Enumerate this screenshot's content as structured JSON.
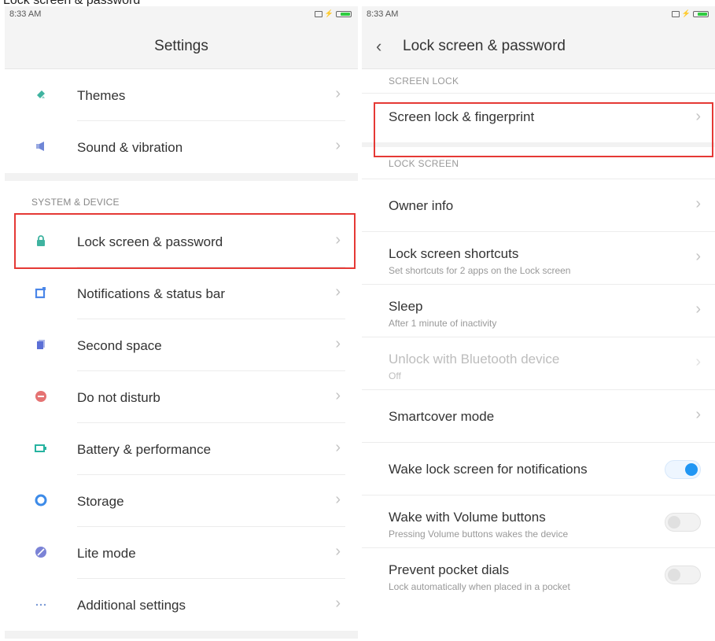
{
  "top_strip_text": "Lock screen & password",
  "left": {
    "status": {
      "time": "8:33 AM"
    },
    "title": "Settings",
    "items_top": [
      {
        "label": "Themes",
        "icon": "brush-icon",
        "color": "#3fb3a0"
      },
      {
        "label": "Sound & vibration",
        "icon": "speaker-icon",
        "color": "#6f86d6"
      }
    ],
    "section_header": "SYSTEM & DEVICE",
    "items": [
      {
        "label": "Lock screen & password",
        "icon": "lock-icon",
        "color": "#3fb3a0"
      },
      {
        "label": "Notifications & status bar",
        "icon": "notification-icon",
        "color": "#4a86e8"
      },
      {
        "label": "Second space",
        "icon": "stack-icon",
        "color": "#5b6fd6"
      },
      {
        "label": "Do not disturb",
        "icon": "do-not-disturb-icon",
        "color": "#e57373"
      },
      {
        "label": "Battery & performance",
        "icon": "battery-icon",
        "color": "#26b3a0"
      },
      {
        "label": "Storage",
        "icon": "storage-icon",
        "color": "#3d8be8"
      },
      {
        "label": "Lite mode",
        "icon": "lite-mode-icon",
        "color": "#7b83d6"
      },
      {
        "label": "Additional settings",
        "icon": "more-icon",
        "color": "#7a9ad6"
      }
    ],
    "chevron": "›"
  },
  "right": {
    "status": {
      "time": "8:33 AM"
    },
    "back": "‹",
    "title": "Lock screen & password",
    "section1_header": "SCREEN LOCK",
    "screen_lock": {
      "label": "Screen lock & fingerprint"
    },
    "section2_header": "LOCK SCREEN",
    "rows": [
      {
        "label": "Owner info"
      },
      {
        "label": "Lock screen shortcuts",
        "sub": "Set shortcuts for 2 apps on the Lock screen"
      },
      {
        "label": "Sleep",
        "sub": "After 1 minute of inactivity"
      },
      {
        "label": "Unlock with Bluetooth device",
        "sub": "Off",
        "disabled": true
      },
      {
        "label": "Smartcover mode"
      }
    ],
    "toggles": [
      {
        "label": "Wake lock screen for notifications",
        "on": true
      },
      {
        "label": "Wake with Volume buttons",
        "sub": "Pressing Volume buttons wakes the device",
        "on": false
      },
      {
        "label": "Prevent pocket dials",
        "sub": "Lock automatically when placed in a pocket",
        "on": false
      }
    ],
    "chevron": "›"
  },
  "colors": {
    "highlight": "#e53935",
    "toggle_on": "#2196f3"
  }
}
